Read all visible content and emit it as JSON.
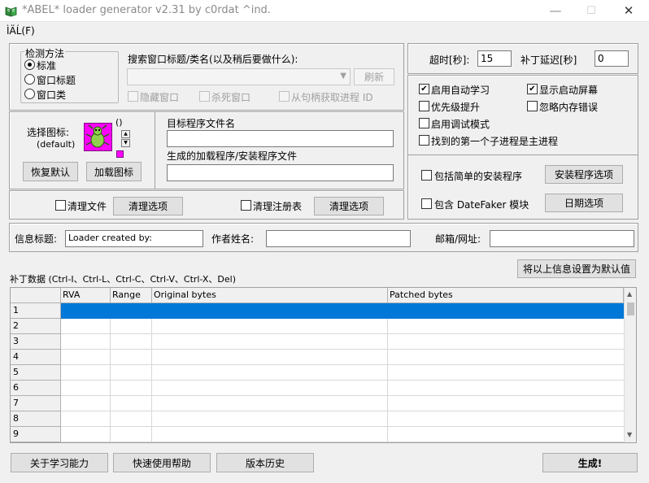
{
  "window": {
    "title": "*ABEL* loader generator v2.31 by c0rdat ^ind.",
    "menu_label": "ÌÄĹ(F)",
    "minimize": "—",
    "maximize": "☐",
    "close": "✕"
  },
  "detect": {
    "title": "检测方法",
    "options": [
      "标准",
      "窗口标题",
      "窗口类"
    ],
    "selected": "标准"
  },
  "search": {
    "label": "搜索窗口标题/类名(以及稍后要做什么):",
    "combo_value": "",
    "refresh_label": "刷新",
    "hide_window": "隐藏窗口",
    "kill_window": "杀死窗口",
    "from_handle": "从句柄获取进程 ID"
  },
  "icon": {
    "select_label": "选择图标:",
    "default_label": "(default)",
    "paren": "()",
    "restore_label": "恢复默认",
    "load_label": "加载图标"
  },
  "files": {
    "target_label": "目标程序文件名",
    "target_value": "",
    "output_label": "生成的加载程序/安装程序文件",
    "output_value": ""
  },
  "clean": {
    "clean_file_label": "清理文件",
    "clean_options_label": "清理选项",
    "clean_registry_label": "清理注册表",
    "registry_options_label": "清理选项"
  },
  "timing": {
    "timeout_label": "超时[秒]:",
    "timeout_value": "15",
    "delay_label": "补丁延迟[秒]",
    "delay_value": "0"
  },
  "options": [
    {
      "label": "启用自动学习",
      "checked": true
    },
    {
      "label": "显示启动屏幕",
      "checked": true
    },
    {
      "label": "优先级提升",
      "checked": false
    },
    {
      "label": "忽略内存错误",
      "checked": false
    },
    {
      "label": "启用调试模式",
      "checked": false
    },
    {
      "label": "找到的第一个子进程是主进程",
      "checked": false
    }
  ],
  "installer": {
    "include_label": "包括简单的安装程序",
    "options_label": "安装程序选项",
    "datefaker_label": "包含 DateFaker 模块",
    "date_options_label": "日期选项"
  },
  "info": {
    "title_label": "信息标题:",
    "title_value": "Loader created by:",
    "author_label": "作者姓名:",
    "author_value": "",
    "email_label": "邮箱/网址:",
    "email_value": ""
  },
  "patch": {
    "section_label": "补丁数据 (Ctrl-I、Ctrl-L、Ctrl-C、Ctrl-V、Ctrl-X、Del)",
    "set_default_label": "将以上信息设置为默认值",
    "columns": [
      "RVA",
      "Range",
      "Original bytes",
      "Patched bytes"
    ],
    "rows": [
      "1",
      "2",
      "3",
      "4",
      "5",
      "6",
      "7",
      "8",
      "9"
    ]
  },
  "bottom": {
    "learn_label": "关于学习能力",
    "help_label": "快速使用帮助",
    "history_label": "版本历史",
    "generate_label": "生成!"
  },
  "colors": {
    "selection": "#0078d7",
    "icon_magenta": "#ff00ff",
    "icon_green": "#8fd14f"
  }
}
